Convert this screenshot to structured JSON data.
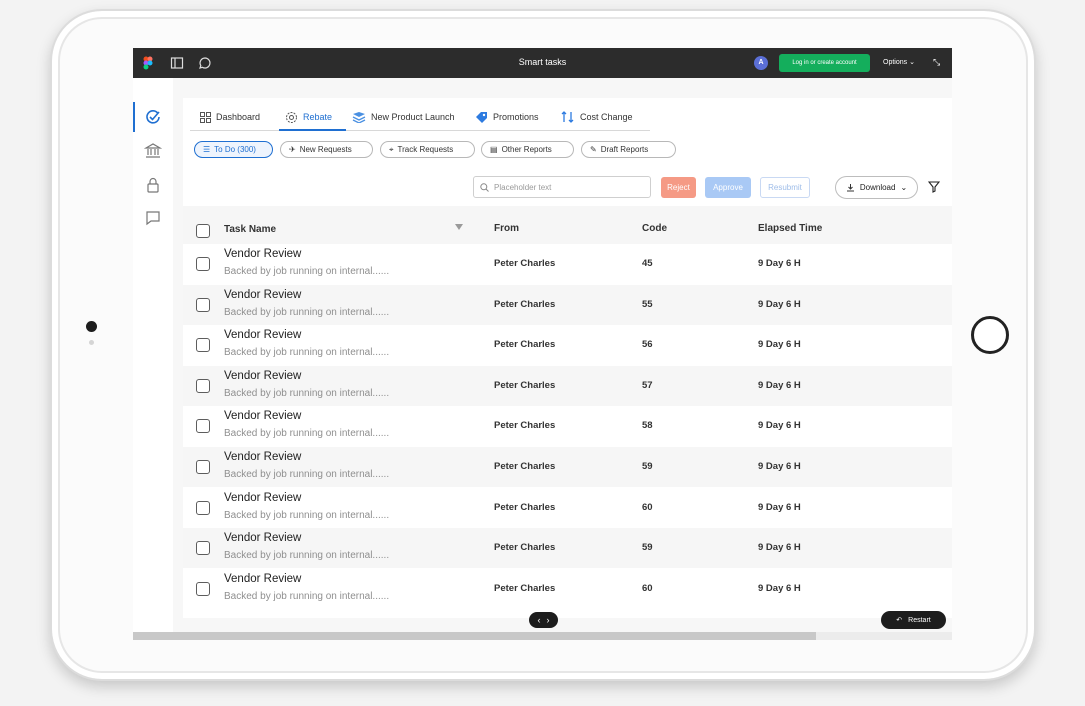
{
  "app": {
    "title": "Smart tasks",
    "avatar_initial": "A",
    "login_label": "Log in or create account",
    "options_label": "Options ⌄",
    "collapse_symbol": "⤡"
  },
  "tabs": [
    {
      "label": "Dashboard",
      "icon": "grid-icon"
    },
    {
      "label": "Rebate",
      "icon": "gear-icon"
    },
    {
      "label": "New Product Launch",
      "icon": "layers-icon"
    },
    {
      "label": "Promotions",
      "icon": "tag-icon"
    },
    {
      "label": "Cost Change",
      "icon": "sort-icon"
    }
  ],
  "chips": [
    {
      "label": "To Do (300)",
      "icon": "list-icon"
    },
    {
      "label": "New Requests",
      "icon": "plane-icon"
    },
    {
      "label": "Track Requests",
      "icon": "crosshair-icon"
    },
    {
      "label": "Other Reports",
      "icon": "document-icon"
    },
    {
      "label": "Draft Reports",
      "icon": "edit-icon"
    }
  ],
  "search": {
    "placeholder": "Placeholder text"
  },
  "actions": {
    "reject": "Reject",
    "approve": "Approve",
    "resubmit": "Resubmit",
    "download": "Download"
  },
  "table": {
    "headers": {
      "task": "Task Name",
      "from": "From",
      "code": "Code",
      "elapsed": "Elapsed Time"
    },
    "rows": [
      {
        "task": "Vendor Review",
        "sub": "Backed by job running on internal......",
        "from": "Peter Charles",
        "code": "45",
        "elapsed": "9 Day 6 H"
      },
      {
        "task": "Vendor Review",
        "sub": "Backed by job running on internal......",
        "from": "Peter Charles",
        "code": "55",
        "elapsed": "9 Day 6 H"
      },
      {
        "task": "Vendor Review",
        "sub": "Backed by job running on internal......",
        "from": "Peter Charles",
        "code": "56",
        "elapsed": "9 Day 6 H"
      },
      {
        "task": "Vendor Review",
        "sub": "Backed by job running on internal......",
        "from": "Peter Charles",
        "code": "57",
        "elapsed": "9 Day 6 H"
      },
      {
        "task": "Vendor Review",
        "sub": "Backed by job running on internal......",
        "from": "Peter Charles",
        "code": "58",
        "elapsed": "9 Day 6 H"
      },
      {
        "task": "Vendor Review",
        "sub": "Backed by job running on internal......",
        "from": "Peter Charles",
        "code": "59",
        "elapsed": "9 Day 6 H"
      },
      {
        "task": "Vendor Review",
        "sub": "Backed by job running on internal......",
        "from": "Peter Charles",
        "code": "60",
        "elapsed": "9 Day 6 H"
      },
      {
        "task": "Vendor Review",
        "sub": "Backed by job running on internal......",
        "from": "Peter Charles",
        "code": "59",
        "elapsed": "9 Day 6 H"
      },
      {
        "task": "Vendor Review",
        "sub": "Backed by job running on internal......",
        "from": "Peter Charles",
        "code": "60",
        "elapsed": "9 Day 6 H"
      }
    ]
  },
  "footer": {
    "pager_prev": "‹",
    "pager_next": "›",
    "restart_label": "Restart"
  },
  "colors": {
    "accent": "#1f6fd1",
    "reject": "#f59a85",
    "approve": "#a9c9f5",
    "login": "#14ae5c",
    "topbar": "#2c2c2c"
  }
}
